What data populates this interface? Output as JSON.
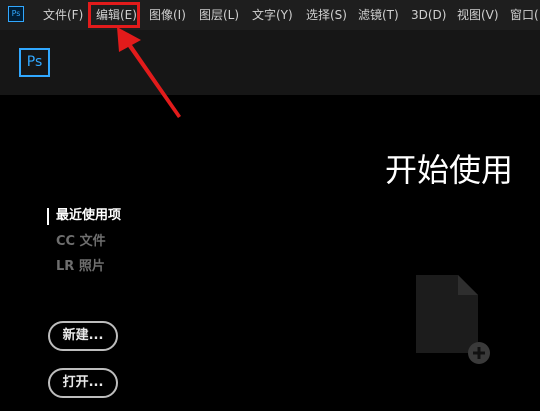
{
  "app": {
    "icon_label": "Ps",
    "logo_label": "Ps",
    "accent_color": "#31a8ff",
    "highlight_color": "#e21b1b"
  },
  "menubar": {
    "items": [
      {
        "label": "文件(F)"
      },
      {
        "label": "编辑(E)"
      },
      {
        "label": "图像(I)"
      },
      {
        "label": "图层(L)"
      },
      {
        "label": "文字(Y)"
      },
      {
        "label": "选择(S)"
      },
      {
        "label": "滤镜(T)"
      },
      {
        "label": "3D(D)"
      },
      {
        "label": "视图(V)"
      },
      {
        "label": "窗口("
      }
    ]
  },
  "welcome": {
    "title": "开始使用"
  },
  "nav": {
    "items": [
      {
        "label": "最近使用项",
        "active": true
      },
      {
        "label": "CC 文件",
        "active": false
      },
      {
        "label": "LR 照片",
        "active": false
      }
    ]
  },
  "actions": {
    "new_label": "新建...",
    "open_label": "打开..."
  },
  "icons": {
    "new_document": "new-document-icon",
    "add": "plus-circle-icon"
  }
}
